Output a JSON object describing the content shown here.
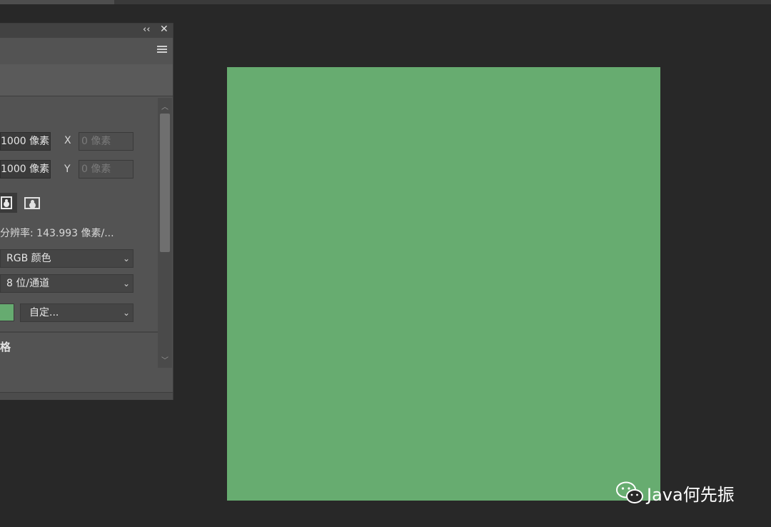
{
  "panel": {
    "controls": {
      "collapse": "‹‹",
      "close": "✕"
    },
    "width_value": "1000 像素",
    "height_value": "1000 像素",
    "x_label": "X",
    "x_placeholder": "0 像素",
    "y_label": "Y",
    "y_placeholder": "0 像素",
    "resolution": "分辨率: 143.993 像素/...",
    "color_mode": "RGB 颜色",
    "bit_depth": "8 位/通道",
    "background_contents": "自定...",
    "background_color": "#66ab70",
    "section_title": "格",
    "scroll_up": "^",
    "scroll_down": "v"
  },
  "canvas": {
    "fill_color": "#67ac70"
  },
  "watermark": {
    "text": "Java何先振",
    "icon": "wechat-icon"
  }
}
